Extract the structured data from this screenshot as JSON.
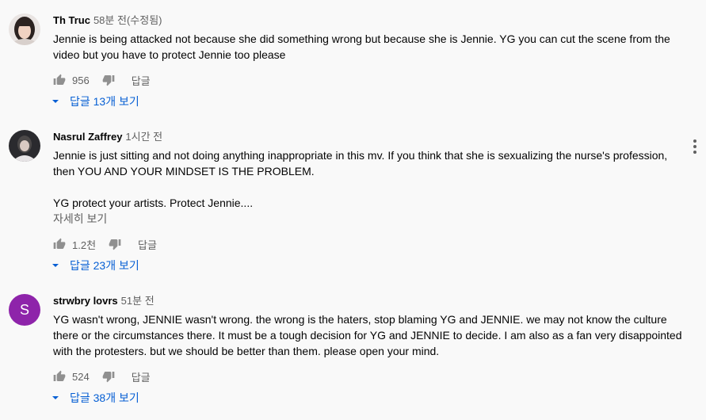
{
  "comments": [
    {
      "author": "Th Truc",
      "time": "58분 전(수정됨)",
      "text": "Jennie is being attacked not because she did something wrong but because she is Jennie. YG you can cut the scene from the video but you have to protect Jennie too please",
      "like_count": "956",
      "reply_label": "답글",
      "view_replies": "답글 13개 보기"
    },
    {
      "author": "Nasrul Zaffrey",
      "time": "1시간 전",
      "text": "Jennie is just sitting and not doing anything inappropriate in this mv. If you think that she is sexualizing the nurse's profession, then YOU AND YOUR MINDSET IS THE PROBLEM.\n\nYG protect your artists. Protect Jennie....",
      "read_more": "자세히 보기",
      "like_count": "1.2천",
      "reply_label": "답글",
      "view_replies": "답글 23개 보기"
    },
    {
      "author": "strwbry lovrs",
      "time": "51분 전",
      "avatar_letter": "S",
      "avatar_color": "#8e24aa",
      "text": "YG wasn't wrong, JENNIE wasn't wrong. the wrong is the haters, stop blaming YG and JENNIE. we may not know the culture there or the circumstances there. It must be a tough decision for YG and JENNIE to decide. I am also as a fan very disappointed with the protesters. but we should be better than them. please open your mind.",
      "like_count": "524",
      "reply_label": "답글",
      "view_replies": "답글 38개 보기"
    }
  ],
  "icons": {
    "like": "thumb-up-icon",
    "dislike": "thumb-down-icon",
    "expand": "caret-down-icon",
    "menu": "more-vert-icon"
  },
  "colors": {
    "link": "#065fd4",
    "secondary_text": "#606060",
    "background": "#f9f9f9"
  }
}
